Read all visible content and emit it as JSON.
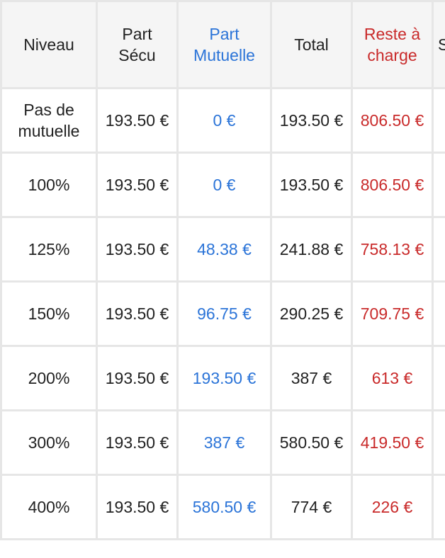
{
  "columns": {
    "niveau": "Niveau",
    "part_secu": "Part Sécu",
    "part_mutuelle": "Part Mutuelle",
    "total": "Total",
    "reste": "Reste à charge",
    "extra": "S"
  },
  "rows": [
    {
      "niveau": "Pas de mutuelle",
      "secu": "193.50 €",
      "mutuelle": "0 €",
      "total": "193.50 €",
      "reste": "806.50 €"
    },
    {
      "niveau": "100%",
      "secu": "193.50 €",
      "mutuelle": "0 €",
      "total": "193.50 €",
      "reste": "806.50 €"
    },
    {
      "niveau": "125%",
      "secu": "193.50 €",
      "mutuelle": "48.38 €",
      "total": "241.88 €",
      "reste": "758.13 €"
    },
    {
      "niveau": "150%",
      "secu": "193.50 €",
      "mutuelle": "96.75 €",
      "total": "290.25 €",
      "reste": "709.75 €"
    },
    {
      "niveau": "200%",
      "secu": "193.50 €",
      "mutuelle": "193.50 €",
      "total": "387 €",
      "reste": "613 €"
    },
    {
      "niveau": "300%",
      "secu": "193.50 €",
      "mutuelle": "387 €",
      "total": "580.50 €",
      "reste": "419.50 €"
    },
    {
      "niveau": "400%",
      "secu": "193.50 €",
      "mutuelle": "580.50 €",
      "total": "774 €",
      "reste": "226 €"
    }
  ],
  "colors": {
    "mutuelle_text": "#2b74d8",
    "reste_text": "#c92a2a",
    "header_bg": "#f5f5f5",
    "border": "#e6e6e6"
  }
}
